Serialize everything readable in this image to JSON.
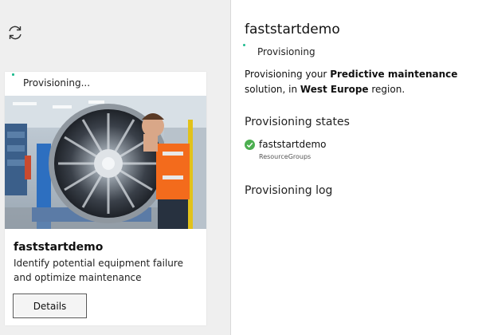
{
  "toolbar": {
    "refresh_icon": "refresh-icon"
  },
  "card": {
    "status": "Provisioning...",
    "image_icon": "jet-engine-photo",
    "title": "faststartdemo",
    "description": "Identify potential equipment failure and optimize maintenance",
    "details_label": "Details"
  },
  "panel": {
    "title": "faststartdemo",
    "status": "Provisioning",
    "message": {
      "part1": "Provisioning your ",
      "solution": "Predictive maintenance",
      "part2": " solution, in ",
      "region": "West Europe",
      "part3": " region."
    },
    "states_heading": "Provisioning states",
    "states": [
      {
        "name": "faststartdemo",
        "type": "ResourceGroups",
        "icon": "check-circle-icon"
      }
    ],
    "log_heading": "Provisioning log"
  },
  "colors": {
    "accent": "#1fbb8f",
    "success": "#4caf50"
  }
}
